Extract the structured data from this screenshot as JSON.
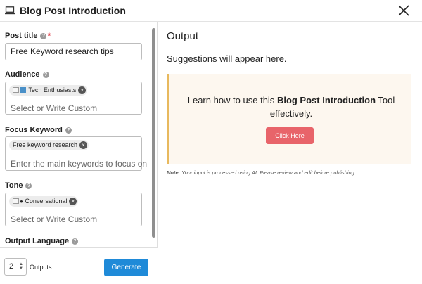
{
  "window": {
    "title": "Blog Post Introduction",
    "app_icon": "laptop-icon",
    "close_icon": "close-icon"
  },
  "form": {
    "post_title": {
      "label": "Post title",
      "required_mark": "*",
      "value": "Free Keyword research tips"
    },
    "audience": {
      "label": "Audience",
      "chips": [
        {
          "label": "Tech Enthusiasts",
          "icon": "broken-image-icon"
        }
      ],
      "placeholder": "Select or Write Custom"
    },
    "focus_keyword": {
      "label": "Focus Keyword",
      "chips": [
        {
          "label": "Free keyword research"
        }
      ],
      "placeholder": "Enter the main keywords to focus on"
    },
    "tone": {
      "label": "Tone",
      "chips": [
        {
          "label": "Conversational",
          "icon": "broken-image-icon"
        }
      ],
      "placeholder": "Select or Write Custom"
    },
    "output_language": {
      "label": "Output Language"
    }
  },
  "footer": {
    "outputs_value": "2",
    "outputs_label": "Outputs",
    "generate_label": "Generate"
  },
  "output": {
    "title": "Output",
    "empty_text": "Suggestions will appear here.",
    "info_prefix": "Learn how to use this ",
    "info_tool": "Blog Post Introduction",
    "info_suffix": " Tool effectively.",
    "click_label": "Click Here",
    "note_label": "Note:",
    "note_text": " Your input is processed using AI. Please review and edit before publishing."
  },
  "colors": {
    "accent_blue": "#1f8ad8",
    "click_button": "#e8646a",
    "info_background": "#fdf7ef",
    "info_border": "#e8b95e",
    "required": "#e0444e"
  }
}
